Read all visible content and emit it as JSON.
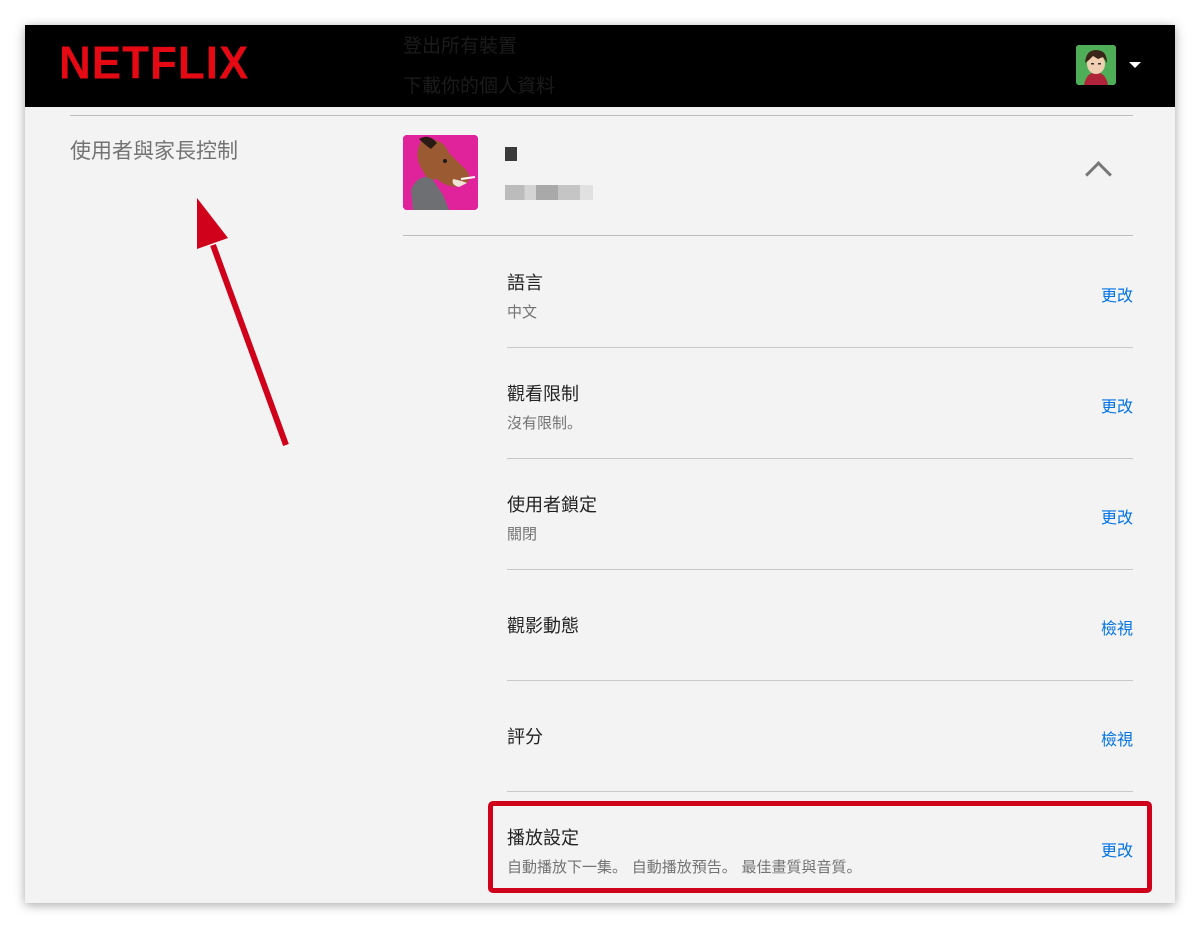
{
  "header": {
    "logo": "NETFLIX",
    "ghost_line_1": "登出所有裝置",
    "ghost_line_2": "下載你的個人資料"
  },
  "sidebar": {
    "section_title": "使用者與家長控制"
  },
  "profile": {
    "name": "■"
  },
  "settings": [
    {
      "label": "語言",
      "desc": "中文",
      "action": "更改"
    },
    {
      "label": "觀看限制",
      "desc": "沒有限制。",
      "action": "更改"
    },
    {
      "label": "使用者鎖定",
      "desc": "關閉",
      "action": "更改"
    },
    {
      "label": "觀影動態",
      "desc": "",
      "action": "檢視"
    },
    {
      "label": "評分",
      "desc": "",
      "action": "檢視"
    },
    {
      "label": "播放設定",
      "desc": "自動播放下一集。 自動播放預告。 最佳畫質與音質。",
      "action": "更改"
    }
  ],
  "colors": {
    "brand": "#e50914",
    "link": "#0073e6",
    "annotation": "#d0021b"
  }
}
